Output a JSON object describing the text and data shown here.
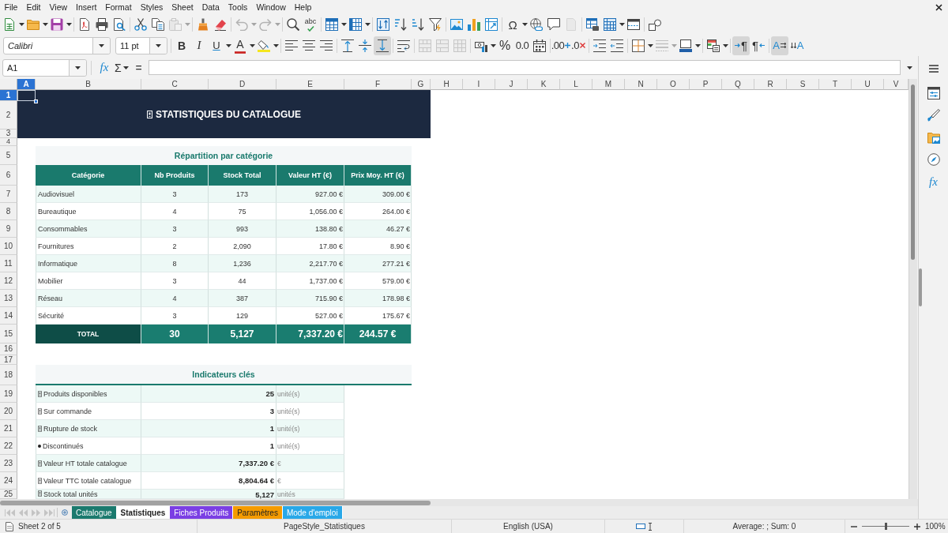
{
  "menu": [
    "File",
    "Edit",
    "View",
    "Insert",
    "Format",
    "Styles",
    "Sheet",
    "Data",
    "Tools",
    "Window",
    "Help"
  ],
  "toolbar_standard": [
    {
      "disabled": false
    },
    {
      "disabled": false
    },
    {
      "disabled": false
    },
    {
      "disabled": false
    },
    {
      "disabled": false
    },
    {
      "disabled": false
    },
    {
      "disabled": false
    },
    {
      "disabled": false
    },
    {
      "disabled": true
    },
    {
      "disabled": false
    },
    {
      "disabled": false
    },
    {
      "disabled": true
    },
    {
      "disabled": true
    },
    {
      "disabled": false
    },
    {
      "label": "abc",
      "disabled": false
    },
    {
      "disabled": false
    },
    {
      "disabled": false
    },
    {
      "disabled": false
    },
    {
      "disabled": false
    },
    {
      "disabled": false
    },
    {
      "disabled": false
    },
    {
      "disabled": false
    },
    {
      "disabled": false
    },
    {
      "disabled": false
    },
    {
      "label": "Ω",
      "disabled": false
    },
    {
      "disabled": false
    },
    {
      "disabled": false
    },
    {
      "disabled": true
    },
    {
      "disabled": false
    },
    {
      "disabled": false
    },
    {
      "disabled": false
    },
    {
      "disabled": false
    }
  ],
  "toolbar_formatting": {
    "font_name": "Calibri",
    "font_size": "11 pt",
    "buttons": [
      {
        "label": "B",
        "disabled": false,
        "on": false
      },
      {
        "label": "I",
        "disabled": false,
        "on": false
      },
      {
        "label": "U",
        "disabled": false,
        "on": false
      },
      {
        "label": "A",
        "disabled": false,
        "on": false
      },
      {
        "disabled": false,
        "on": false
      },
      {
        "disabled": false,
        "on": false
      },
      {
        "disabled": false,
        "on": false
      },
      {
        "disabled": false,
        "on": false
      },
      {
        "disabled": false,
        "on": false
      },
      {
        "disabled": false,
        "on": false
      },
      {
        "disabled": false,
        "on": true
      },
      {
        "disabled": false,
        "on": false
      },
      {
        "disabled": true,
        "on": false
      },
      {
        "disabled": true,
        "on": false
      },
      {
        "disabled": true,
        "on": false
      },
      {
        "disabled": false,
        "on": false
      },
      {
        "label": "%",
        "disabled": false,
        "on": false
      },
      {
        "label": "0.0",
        "disabled": false,
        "on": false
      },
      {
        "disabled": false,
        "on": false
      },
      {
        "label": ".00",
        "disabled": false,
        "on": false
      },
      {
        "label": ".0",
        "disabled": false,
        "on": false
      },
      {
        "disabled": false,
        "on": false
      },
      {
        "disabled": false,
        "on": false
      },
      {
        "disabled": false,
        "on": false
      },
      {
        "disabled": true,
        "on": false
      },
      {
        "disabled": false,
        "on": false
      },
      {
        "disabled": false,
        "on": false
      },
      {
        "label": "¶",
        "disabled": false,
        "on": true
      },
      {
        "label": "¶",
        "disabled": false,
        "on": false
      },
      {
        "label": "A",
        "disabled": false,
        "on": true
      },
      {
        "label": "A",
        "disabled": false,
        "on": false
      }
    ]
  },
  "formula_bar": {
    "name_box": "A1",
    "function_wizard": "fx",
    "sum": "Σ",
    "formula": "="
  },
  "sheet": {
    "columns": [
      {
        "label": "A",
        "selected": true
      },
      {
        "label": "B",
        "selected": false
      },
      {
        "label": "C",
        "selected": false
      },
      {
        "label": "D",
        "selected": false
      },
      {
        "label": "E",
        "selected": false
      },
      {
        "label": "F",
        "selected": false
      },
      {
        "label": "G",
        "selected": false
      },
      {
        "label": "H",
        "selected": false
      },
      {
        "label": "I",
        "selected": false
      },
      {
        "label": "J",
        "selected": false
      },
      {
        "label": "K",
        "selected": false
      },
      {
        "label": "L",
        "selected": false
      },
      {
        "label": "M",
        "selected": false
      },
      {
        "label": "N",
        "selected": false
      },
      {
        "label": "O",
        "selected": false
      },
      {
        "label": "P",
        "selected": false
      },
      {
        "label": "Q",
        "selected": false
      },
      {
        "label": "R",
        "selected": false
      },
      {
        "label": "S",
        "selected": false
      },
      {
        "label": "T",
        "selected": false
      },
      {
        "label": "U",
        "selected": false
      },
      {
        "label": "V",
        "selected": false
      }
    ],
    "rows": [
      {
        "label": "1",
        "selected": true
      },
      {
        "label": "2",
        "selected": false
      },
      {
        "label": "3",
        "selected": false
      },
      {
        "label": "4",
        "selected": false
      },
      {
        "label": "5",
        "selected": false
      },
      {
        "label": "6",
        "selected": false
      },
      {
        "label": "7",
        "selected": false
      },
      {
        "label": "8",
        "selected": false
      },
      {
        "label": "9",
        "selected": false
      },
      {
        "label": "10",
        "selected": false
      },
      {
        "label": "11",
        "selected": false
      },
      {
        "label": "12",
        "selected": false
      },
      {
        "label": "13",
        "selected": false
      },
      {
        "label": "14",
        "selected": false
      },
      {
        "label": "15",
        "selected": false
      },
      {
        "label": "16",
        "selected": false
      },
      {
        "label": "17",
        "selected": false
      },
      {
        "label": "18",
        "selected": false
      },
      {
        "label": "19",
        "selected": false
      },
      {
        "label": "20",
        "selected": false
      },
      {
        "label": "21",
        "selected": false
      },
      {
        "label": "22",
        "selected": false
      },
      {
        "label": "23",
        "selected": false
      },
      {
        "label": "24",
        "selected": false
      },
      {
        "label": "25",
        "selected": false
      }
    ],
    "banner": {
      "title": "STATISTIQUES DU CATALOGUE"
    },
    "category_table": {
      "title": "Répartition par catégorie",
      "columns": [
        "Catégorie",
        "Nb Produits",
        "Stock Total",
        "Valeur HT (€)",
        "Prix Moy. HT (€)"
      ],
      "rows": [
        [
          "Audiovisuel",
          "3",
          "173",
          "927.00 €",
          "309.00 €"
        ],
        [
          "Bureautique",
          "4",
          "75",
          "1,056.00 €",
          "264.00 €"
        ],
        [
          "Consommables",
          "3",
          "993",
          "138.80 €",
          "46.27 €"
        ],
        [
          "Fournitures",
          "2",
          "2,090",
          "17.80 €",
          "8.90 €"
        ],
        [
          "Informatique",
          "8",
          "1,236",
          "2,217.70 €",
          "277.21 €"
        ],
        [
          "Mobilier",
          "3",
          "44",
          "1,737.00 €",
          "579.00 €"
        ],
        [
          "Réseau",
          "4",
          "387",
          "715.90 €",
          "178.98 €"
        ],
        [
          "Sécurité",
          "3",
          "129",
          "527.00 €",
          "175.67 €"
        ]
      ],
      "total": [
        "TOTAL",
        "30",
        "5,127",
        "7,337.20 €",
        "244.57 €"
      ]
    },
    "indicators": {
      "title": "Indicateurs clés",
      "rows": [
        {
          "kind": "tofu",
          "label": "Produits disponibles",
          "value": "25",
          "unit": "unité(s)"
        },
        {
          "kind": "tofu",
          "label": "Sur commande",
          "value": "3",
          "unit": "unité(s)"
        },
        {
          "kind": "tofu",
          "label": "Rupture de stock",
          "value": "1",
          "unit": "unité(s)"
        },
        {
          "kind": "bullet",
          "label": "Discontinués",
          "value": "1",
          "unit": "unité(s)"
        },
        {
          "kind": "tofu",
          "label": "Valeur HT totale catalogue",
          "value": "7,337.20 €",
          "unit": "€"
        },
        {
          "kind": "tofu",
          "label": "Valeur TTC totale catalogue",
          "value": "8,804.64 €",
          "unit": "€"
        },
        {
          "kind": "tofu",
          "label": "Stock total unités",
          "value": "5,127",
          "unit": "unités"
        }
      ]
    }
  },
  "sidebar": {
    "functions": "fx"
  },
  "sheet_tabs": {
    "navigation_disabled": true,
    "tabs": [
      {
        "label": "Catalogue",
        "color": "#1b7a6e",
        "selected": false
      },
      {
        "label": "Statistiques",
        "selected": true
      },
      {
        "label": "Fiches Produits",
        "color": "#7b3fe4",
        "selected": false
      },
      {
        "label": "Paramètres",
        "color": "#f59b00",
        "selected": false
      },
      {
        "label": "Mode d'emploi",
        "color": "#29a8e8",
        "selected": false
      }
    ]
  },
  "status_bar": {
    "sheet": "Sheet 2 of 5",
    "page_style": "PageStyle_Statistiques",
    "language": "English (USA)",
    "summary": "Average: ; Sum: 0",
    "zoom_slider": {
      "level": 0.5
    },
    "zoom": "100%"
  }
}
